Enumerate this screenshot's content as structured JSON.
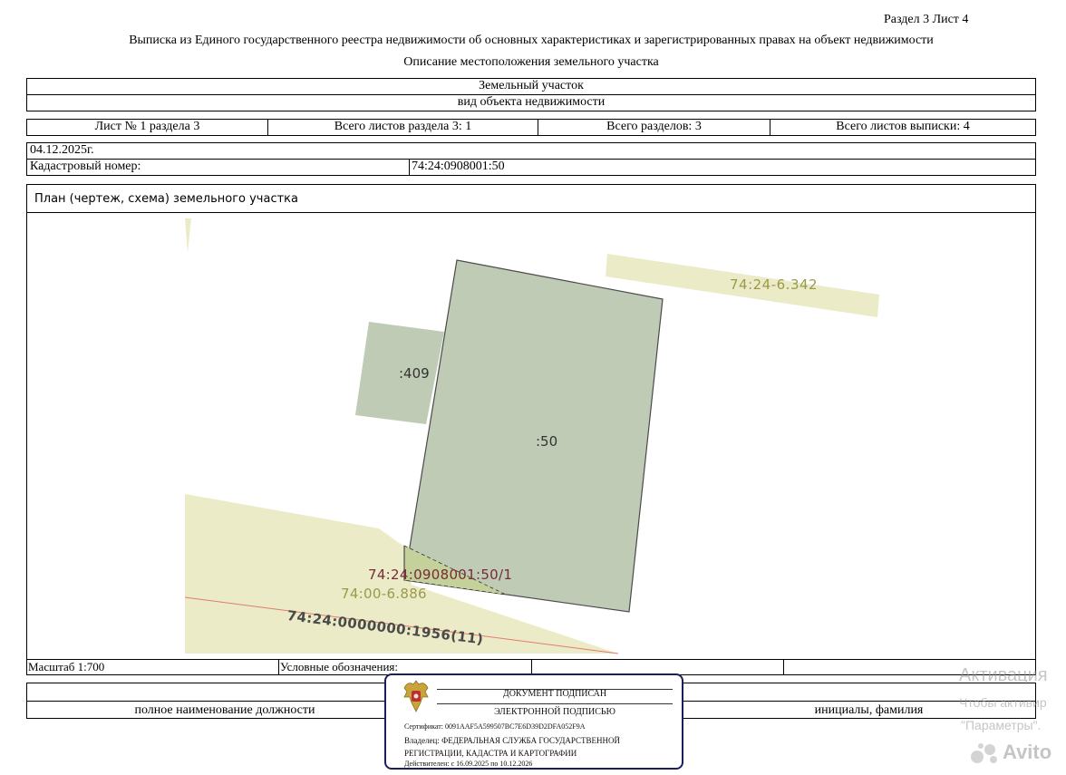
{
  "header": {
    "section_sheet": "Раздел 3   Лист 4",
    "title": "Выписка из Единого государственного реестра недвижимости об основных характеристиках и зарегистрированных правах на объект недвижимости",
    "subtitle": "Описание местоположения земельного участка"
  },
  "object": {
    "type": "Земельный участок",
    "type_caption": "вид объекта недвижимости"
  },
  "sheets": {
    "sheet_no": "Лист № 1 раздела 3",
    "total_section_sheets": "Всего листов раздела 3: 1",
    "total_sections": "Всего разделов: 3",
    "total_extract_sheets": "Всего листов выписки: 4"
  },
  "date": "04.12.2025г.",
  "cadastral": {
    "label": "Кадастровый номер:",
    "value": "74:24:0908001:50"
  },
  "plan": {
    "title": "План (чертеж, схема) земельного участка",
    "labels": {
      "main_parcel": ":50",
      "neighbor_parcel": ":409",
      "top_right": "74:24-6.342",
      "part": "74:24:0908001:50/1",
      "zone": "74:00-6.886",
      "road": "74:24:0000000:1956(11)"
    }
  },
  "footer": {
    "scale": "Масштаб 1:700",
    "legend": "Условные обозначения:",
    "position_caption": "полное наименование должности",
    "name_caption": "инициалы, фамилия"
  },
  "stamp": {
    "line1": "ДОКУМЕНТ ПОДПИСАН",
    "line2": "ЭЛЕКТРОННОЙ ПОДПИСЬЮ",
    "certificate": "Сертификат: 0091AAF5A599507BC7E6D39D2DFA052F9A",
    "owner_line1": "Владелец: ФЕДЕРАЛЬНАЯ СЛУЖБА ГОСУДАРСТВЕННОЙ",
    "owner_line2": "РЕГИСТРАЦИИ, КАДАСТРА И КАРТОГРАФИИ",
    "valid": "Действителен: с 16.09.2025 по 10.12.2026"
  },
  "watermark": {
    "line1": "Активация",
    "line2": "Чтобы активир",
    "line3": "\"Параметры\".",
    "brand": "Avito"
  },
  "colors": {
    "parcel_fill": "#bfcbb4",
    "parcel_stroke": "#4a4a4a",
    "zone_fill": "#ecebc8",
    "label_olive": "#9a9a4a",
    "label_maroon": "#7a2a3a",
    "stamp_border": "#1a1f5c",
    "road_line": "#e27b6b"
  }
}
